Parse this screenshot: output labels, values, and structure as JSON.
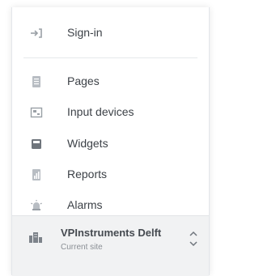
{
  "menu": {
    "items": [
      {
        "label": "Sign-in",
        "icon": "sign-in-icon"
      },
      {
        "label": "Pages",
        "icon": "pages-icon"
      },
      {
        "label": "Input devices",
        "icon": "input-devices-icon"
      },
      {
        "label": "Widgets",
        "icon": "widgets-icon"
      },
      {
        "label": "Reports",
        "icon": "reports-icon"
      },
      {
        "label": "Alarms",
        "icon": "alarms-icon"
      }
    ]
  },
  "site": {
    "name": "VPInstruments Delft",
    "subtitle": "Current site",
    "icon": "building-icon",
    "toggle_icon": "chevron-up-down-icon"
  },
  "colors": {
    "text": "#3c4147",
    "icon": "#9aa0a6",
    "site_bar_bg": "#f1f2f3"
  }
}
